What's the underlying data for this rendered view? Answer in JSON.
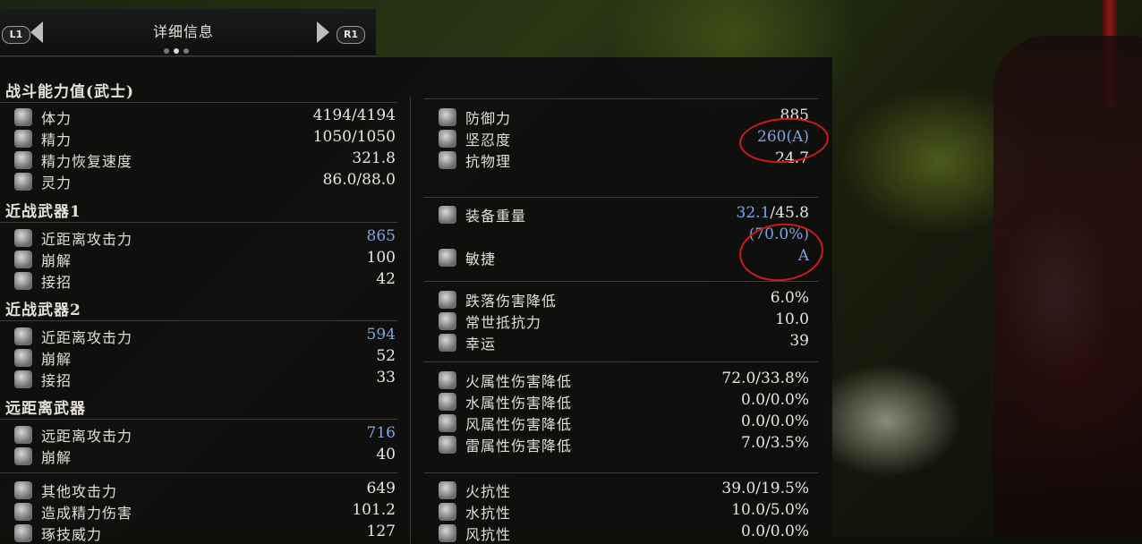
{
  "header": {
    "left_button": "L1",
    "right_button": "R1",
    "title": "详细信息"
  },
  "left_column": {
    "sections": [
      {
        "title": "战斗能力值(武士)",
        "rows": [
          {
            "icon": "body-icon",
            "label": "体力",
            "value": "4194/4194"
          },
          {
            "icon": "spirit-icon",
            "label": "精力",
            "value": "1050/1050"
          },
          {
            "icon": "stamina-regen-icon",
            "label": "精力恢复速度",
            "value": "321.8"
          },
          {
            "icon": "soul-icon",
            "label": "灵力",
            "value": "86.0/88.0"
          }
        ]
      },
      {
        "title": "近战武器1",
        "rows": [
          {
            "icon": "sword-icon",
            "label": "近距离攻击力",
            "value": "865",
            "highlight": true
          },
          {
            "icon": "break-icon",
            "label": "崩解",
            "value": "100"
          },
          {
            "icon": "counter-icon",
            "label": "接招",
            "value": "42"
          }
        ]
      },
      {
        "title": "近战武器2",
        "rows": [
          {
            "icon": "sword-icon",
            "label": "近距离攻击力",
            "value": "594",
            "highlight": true
          },
          {
            "icon": "break-icon",
            "label": "崩解",
            "value": "52"
          },
          {
            "icon": "counter-icon",
            "label": "接招",
            "value": "33"
          }
        ]
      },
      {
        "title": "远距离武器",
        "rows": [
          {
            "icon": "bow-icon",
            "label": "远距离攻击力",
            "value": "716",
            "highlight": true
          },
          {
            "icon": "break-icon",
            "label": "崩解",
            "value": "40"
          }
        ]
      },
      {
        "title": "",
        "rows": [
          {
            "icon": "other-attack-icon",
            "label": "其他攻击力",
            "value": "649"
          },
          {
            "icon": "ki-damage-icon",
            "label": "造成精力伤害",
            "value": "101.2"
          },
          {
            "icon": "skill-icon",
            "label": "琢技威力",
            "value": "127"
          }
        ]
      }
    ]
  },
  "right_column": {
    "groups": [
      {
        "rows": [
          {
            "icon": "defense-icon",
            "label": "防御力",
            "value": "885"
          },
          {
            "icon": "toughness-icon",
            "label": "坚忍度",
            "value": "260(A)",
            "highlight": true
          },
          {
            "icon": "physical-resist-icon",
            "label": "抗物理",
            "value": "24.7"
          }
        ]
      },
      {
        "rows": [
          {
            "icon": "weight-icon",
            "label": "装备重量",
            "value_highlight": "32.1",
            "value_rest": "/45.8"
          },
          {
            "icon": "",
            "label": "",
            "value": "(70.0%)",
            "highlight": true
          },
          {
            "icon": "agility-icon",
            "label": "敏捷",
            "value": "A",
            "highlight": true
          }
        ]
      },
      {
        "rows": [
          {
            "icon": "fall-icon",
            "label": "跌落伤害降低",
            "value": "6.0%"
          },
          {
            "icon": "resist-icon",
            "label": "常世抵抗力",
            "value": "10.0"
          },
          {
            "icon": "luck-icon",
            "label": "幸运",
            "value": "39"
          }
        ]
      },
      {
        "rows": [
          {
            "icon": "fire-icon",
            "label": "火属性伤害降低",
            "value": "72.0/33.8%"
          },
          {
            "icon": "water-icon",
            "label": "水属性伤害降低",
            "value": "0.0/0.0%"
          },
          {
            "icon": "wind-icon",
            "label": "风属性伤害降低",
            "value": "0.0/0.0%"
          },
          {
            "icon": "thunder-icon",
            "label": "雷属性伤害降低",
            "value": "7.0/3.5%"
          }
        ]
      },
      {
        "rows": [
          {
            "icon": "fire-resist-icon",
            "label": "火抗性",
            "value": "39.0/19.5%"
          },
          {
            "icon": "water-resist-icon",
            "label": "水抗性",
            "value": "10.0/5.0%"
          },
          {
            "icon": "wind-resist-icon",
            "label": "风抗性",
            "value": "0.0/0.0%"
          }
        ]
      }
    ]
  },
  "annotations": {
    "color": "#d01a1a"
  }
}
